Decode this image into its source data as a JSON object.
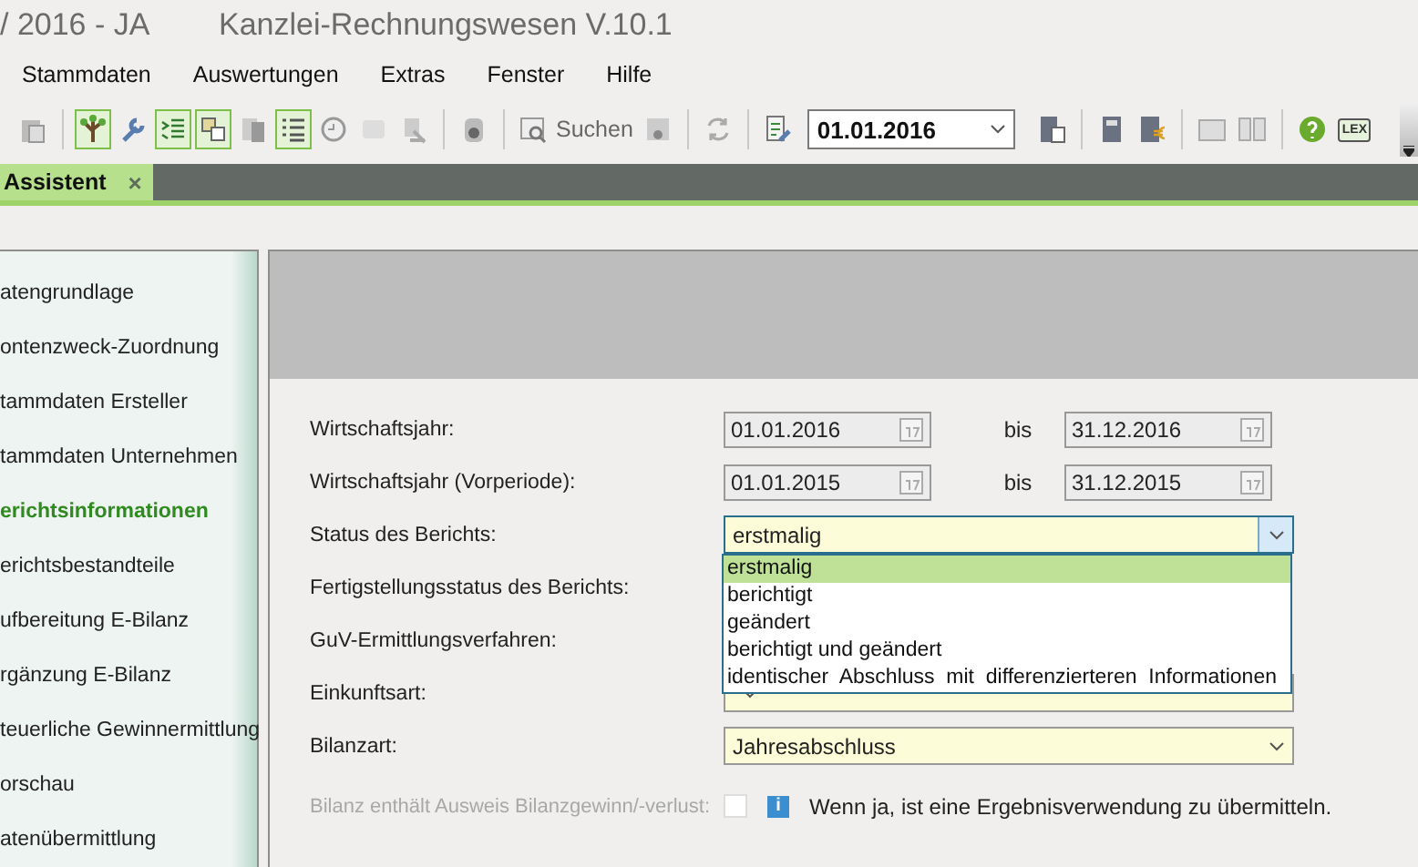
{
  "window": {
    "title_left": "/ 2016 - JA",
    "title": "Kanzlei-Rechnungswesen V.10.1"
  },
  "menu": [
    "Stammdaten",
    "Auswertungen",
    "Extras",
    "Fenster",
    "Hilfe"
  ],
  "toolbar": [
    {
      "kind": "clipboard",
      "on": false
    },
    {
      "kind": "separator"
    },
    {
      "kind": "tree",
      "on": true
    },
    {
      "kind": "wrench",
      "on": false
    },
    {
      "kind": "indent",
      "on": true
    },
    {
      "kind": "windows",
      "on": true
    },
    {
      "kind": "pages",
      "on": false
    },
    {
      "kind": "list",
      "on": true
    },
    {
      "kind": "clock",
      "on": false
    },
    {
      "kind": "note",
      "on": false
    },
    {
      "kind": "stamp",
      "on": false
    },
    {
      "kind": "separator"
    },
    {
      "kind": "camera",
      "on": false
    },
    {
      "kind": "separator"
    },
    {
      "kind": "search",
      "label": "Suchen",
      "on": false
    },
    {
      "kind": "printer",
      "on": false
    },
    {
      "kind": "separator"
    },
    {
      "kind": "refresh",
      "on": false
    },
    {
      "kind": "separator"
    },
    {
      "kind": "editdoc",
      "on": false
    },
    {
      "kind": "date",
      "value": "01.01.2016"
    },
    {
      "kind": "calcdoc",
      "on": false
    },
    {
      "kind": "separator"
    },
    {
      "kind": "calculator",
      "on": false
    },
    {
      "kind": "calceuro",
      "on": false
    },
    {
      "kind": "separator"
    },
    {
      "kind": "folder",
      "on": false
    },
    {
      "kind": "book",
      "on": false
    },
    {
      "kind": "separator"
    },
    {
      "kind": "help",
      "on": false
    },
    {
      "kind": "lex",
      "label": "LEX",
      "on": false
    }
  ],
  "tabs": [
    {
      "label": "Assistent",
      "close": "×",
      "selected": true
    }
  ],
  "sidebar": {
    "items": [
      {
        "label": "atengrundlage",
        "selected": false
      },
      {
        "label": "ontenzweck-Zuordnung",
        "selected": false
      },
      {
        "label": "tammdaten Ersteller",
        "selected": false
      },
      {
        "label": "tammdaten Unternehmen",
        "selected": false
      },
      {
        "label": "erichtsinformationen",
        "selected": true
      },
      {
        "label": "erichtsbestandteile",
        "selected": false
      },
      {
        "label": "ufbereitung E-Bilanz",
        "selected": false
      },
      {
        "label": "rgänzung E-Bilanz",
        "selected": false
      },
      {
        "label": "teuerliche Gewinnermittlung",
        "selected": false
      },
      {
        "label": "orschau",
        "selected": false
      },
      {
        "label": "atenübermittlung",
        "selected": false
      }
    ]
  },
  "form": {
    "rows": [
      {
        "kind": "daterange",
        "label": "Wirtschaftsjahr:",
        "from": "01.01.2016",
        "sep": "bis",
        "to": "31.12.2016"
      },
      {
        "kind": "daterange",
        "label": "Wirtschaftsjahr (Vorperiode):",
        "from": "01.01.2015",
        "sep": "bis",
        "to": "31.12.2015"
      },
      {
        "kind": "combo",
        "label": "Status des Berichts:",
        "value": "erstmalig",
        "expanded": true,
        "options": [
          {
            "label": "erstmalig",
            "selected": true
          },
          {
            "label": "berichtigt",
            "selected": false
          },
          {
            "label": "geändert",
            "selected": false
          },
          {
            "label": "berichtigt und geändert",
            "selected": false
          },
          {
            "label": "identischer  Abschluss  mit  differenzierteren  Informationen",
            "selected": false
          }
        ]
      },
      {
        "kind": "hidden",
        "label": "Fertigstellungsstatus des Berichts:"
      },
      {
        "kind": "hidden",
        "label": "GuV-Ermittlungsverfahren:"
      },
      {
        "kind": "combo",
        "label": "Einkunftsart:",
        "expanded": false
      },
      {
        "kind": "combo",
        "label": "Bilanzart:",
        "value": "Jahresabschluss",
        "expanded": false
      },
      {
        "kind": "check",
        "label": "Bilanz enthält Ausweis Bilanzgewinn/-verlust:",
        "disabled": true,
        "checked": false,
        "info": "i",
        "note": "Wenn ja, ist eine Ergebnisverwendung zu übermitteln."
      }
    ]
  }
}
